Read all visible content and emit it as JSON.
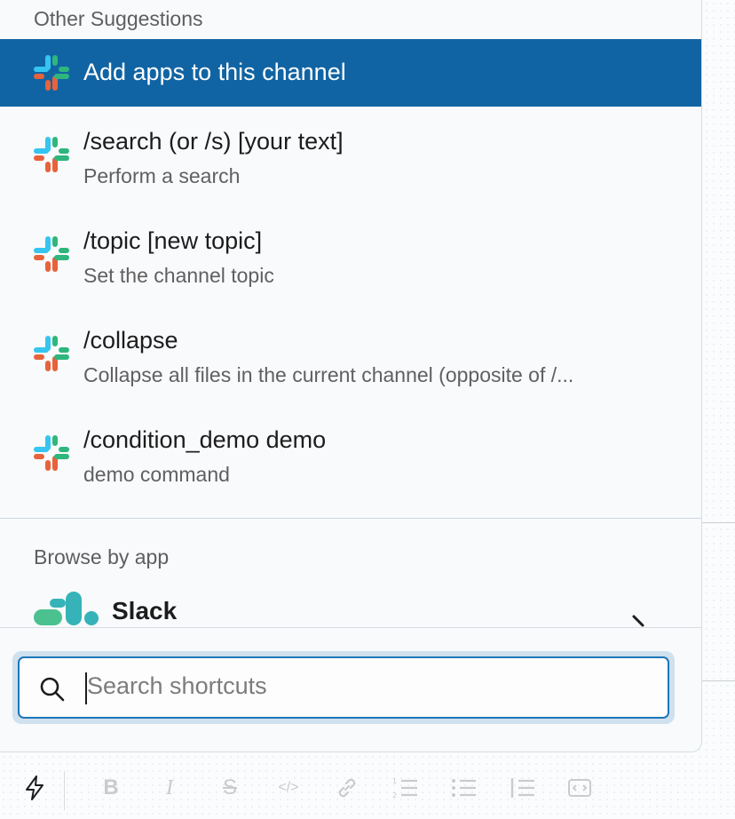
{
  "colors": {
    "selected_bg": "#1164a3",
    "focus_border": "#1d77b8",
    "slack_blue": "#36c5f0",
    "slack_teal": "#2eb67d",
    "slack_red": "#e01e5a",
    "slack_orange": "#e8623b"
  },
  "suggestions": {
    "header": "Other Suggestions",
    "items": [
      {
        "title": "Add apps to this channel",
        "desc": "",
        "selected": true,
        "icon": "slack-logo-icon"
      },
      {
        "title": "/search (or /s) [your text]",
        "desc": "Perform a search",
        "icon": "slack-logo-icon"
      },
      {
        "title": "/topic [new topic]",
        "desc": "Set the channel topic",
        "icon": "slack-logo-icon"
      },
      {
        "title": "/collapse",
        "desc": "Collapse all files in the current channel (opposite of /...",
        "icon": "slack-logo-icon"
      },
      {
        "title": "/condition_demo demo",
        "desc": "demo command",
        "icon": "slack-logo-icon"
      }
    ]
  },
  "browse": {
    "header": "Browse by app",
    "app_name": "Slack",
    "icon": "slack-app-logo-icon"
  },
  "search": {
    "placeholder": "Search shortcuts",
    "icon": "search-icon"
  },
  "toolbar": {
    "shortcuts_icon": "lightning-icon",
    "bold": "B",
    "italic": "I",
    "strike": "S",
    "code": "</>",
    "icons": [
      "bold-icon",
      "italic-icon",
      "strikethrough-icon",
      "code-icon",
      "link-icon",
      "ordered-list-icon",
      "bulleted-list-icon",
      "blockquote-icon",
      "code-block-icon"
    ]
  }
}
